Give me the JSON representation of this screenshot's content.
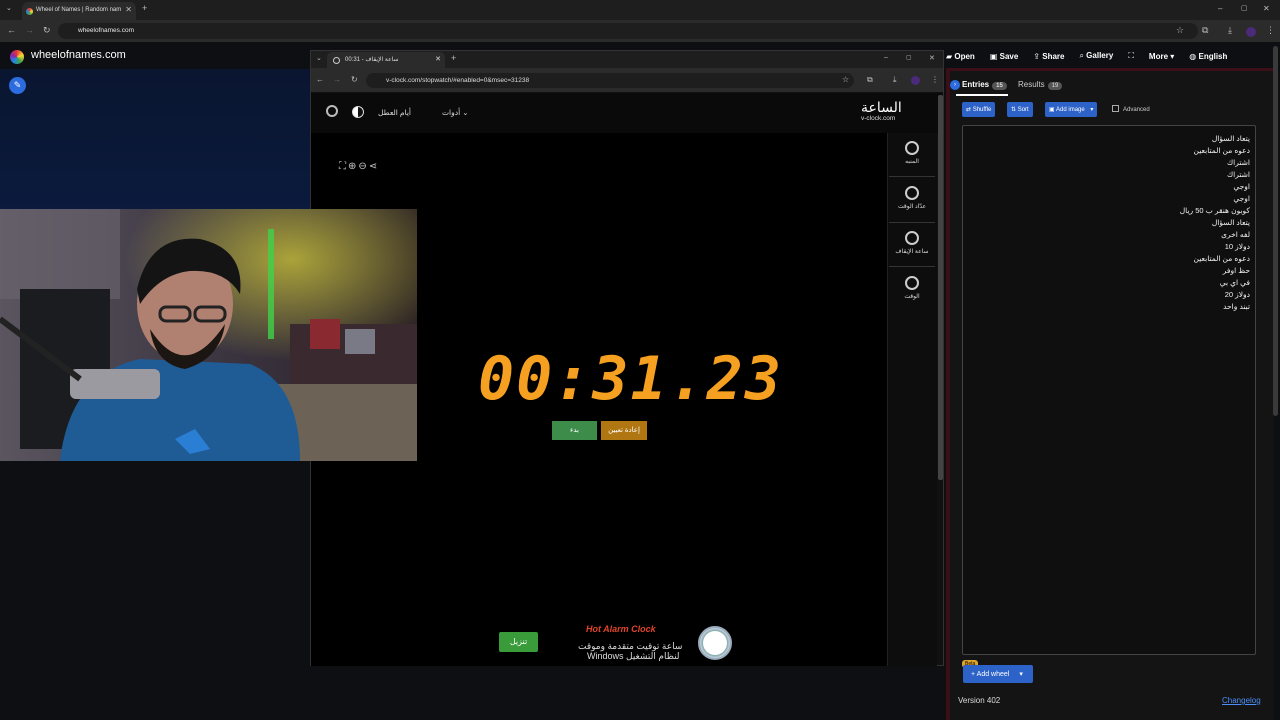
{
  "outer_browser": {
    "tab_title": "Wheel of Names | Random nam",
    "url": "wheelofnames.com"
  },
  "wheel": {
    "site_name": "wheelofnames.com",
    "toolbar": [
      "Open",
      "Save",
      "Share",
      "Gallery",
      "More",
      "English"
    ],
    "tabs": {
      "entries": "Entries",
      "entries_count": "15",
      "results": "Results",
      "results_count": "19"
    },
    "buttons": {
      "shuffle": "Shuffle",
      "sort": "Sort",
      "add_image": "Add image",
      "advanced": "Advanced"
    },
    "entries": [
      "يتعاد السؤال",
      "دعوه من المتابعين",
      "اشتراك",
      "اشتراك",
      "اوجي",
      "اوجي",
      "كوبون هنقر ب 50 ريال",
      "يتعاد السؤال",
      "لفه اخرى",
      "دولاز 10",
      "دعوه من المتابعين",
      "حظ اوفر",
      "في اي بي",
      "دولاز 20",
      "تبند واحد"
    ],
    "beta": "Beta",
    "add_wheel": "Add wheel",
    "version": "Version 402",
    "changelog": "Changelog"
  },
  "vclock": {
    "tab_title": "ساعة الإيقاف - 00:31",
    "url": "v-clock.com/stopwatch/#enabled=0&msec=31238",
    "logo_ar": "الساعة",
    "logo_en": "v-clock.com",
    "nav_holidays": "أيام العطل",
    "nav_tools": "أدوات",
    "sidebar": [
      "المنبه",
      "عدّاد الوقت",
      "ساعة الإيقاف",
      "الوقت"
    ],
    "timer": "00:31.23",
    "start": "بدء",
    "reset": "إعادة تعيين",
    "download": "تنزيل",
    "ad_title": "Hot Alarm Clock",
    "ad_line1": "ساعة توقيت متقدمة وموقت",
    "ad_line2": "Windows لنظام التشغيل"
  }
}
